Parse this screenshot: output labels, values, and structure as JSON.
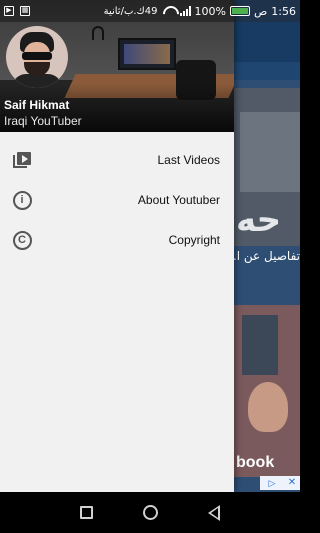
{
  "status_bar": {
    "time": "1:56",
    "time_suffix": "ص",
    "battery": "100%",
    "network_speed": "49ك.ب/ثانية",
    "network_type": "3G"
  },
  "drawer": {
    "profile": {
      "name": "Saif Hikmat",
      "subtitle": "Iraqi YouTuber"
    },
    "menu": [
      {
        "label": "Last Videos",
        "icon": "video-library-icon"
      },
      {
        "label": "About Youtuber",
        "icon": "info-icon"
      },
      {
        "label": "Copyright",
        "icon": "copyright-icon"
      }
    ]
  },
  "background": {
    "video_title": "تفاصيل عن ا... العراقي !!",
    "thumb_text_top": "حه",
    "thumb_text_bottom": "book",
    "ad_label": "Ad"
  },
  "navigation": {
    "buttons": [
      "recent-apps",
      "home",
      "back"
    ]
  }
}
